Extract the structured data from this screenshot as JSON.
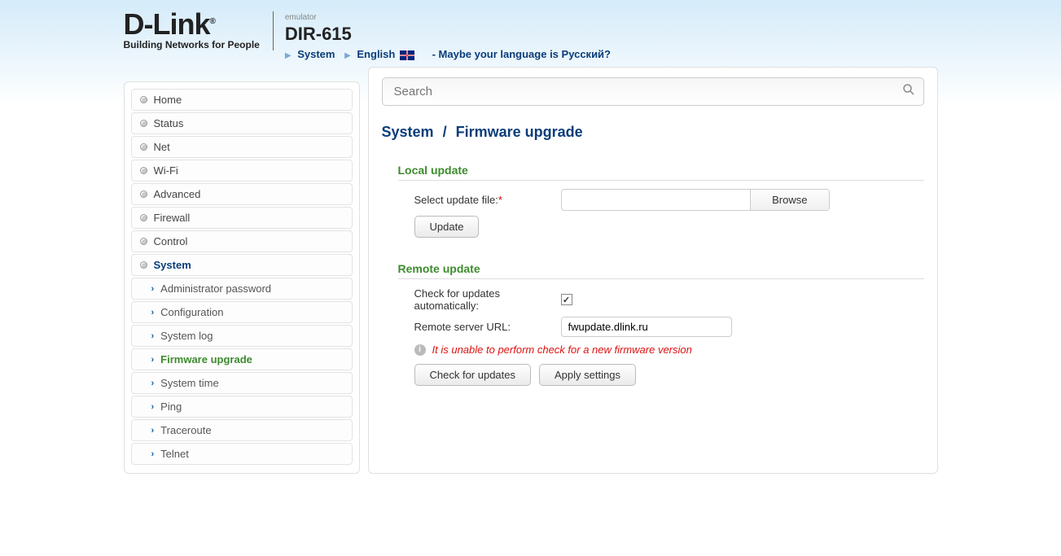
{
  "header": {
    "logo_main": "D-Link",
    "logo_tagline": "Building Networks for People",
    "emulator_label": "emulator",
    "model": "DIR-615",
    "breadcrumb_system": "System",
    "breadcrumb_lang": "English",
    "lang_suggest": "- Maybe your language is Русский?"
  },
  "sidebar": {
    "items": [
      {
        "label": "Home"
      },
      {
        "label": "Status"
      },
      {
        "label": "Net"
      },
      {
        "label": "Wi-Fi"
      },
      {
        "label": "Advanced"
      },
      {
        "label": "Firewall"
      },
      {
        "label": "Control"
      },
      {
        "label": "System",
        "active": true
      }
    ],
    "subitems": [
      {
        "label": "Administrator password"
      },
      {
        "label": "Configuration"
      },
      {
        "label": "System log"
      },
      {
        "label": "Firmware upgrade",
        "active": true
      },
      {
        "label": "System time"
      },
      {
        "label": "Ping"
      },
      {
        "label": "Traceroute"
      },
      {
        "label": "Telnet"
      }
    ]
  },
  "search": {
    "placeholder": "Search"
  },
  "page": {
    "crumb1": "System",
    "sep": "/",
    "crumb2": "Firmware upgrade"
  },
  "local": {
    "title": "Local update",
    "select_label": "Select update file:",
    "browse": "Browse",
    "update_btn": "Update"
  },
  "remote": {
    "title": "Remote update",
    "auto_label": "Check for updates automatically:",
    "auto_checked": true,
    "url_label": "Remote server URL:",
    "url_value": "fwupdate.dlink.ru",
    "error_msg": "It is unable to perform check for a new firmware version",
    "check_btn": "Check for updates",
    "apply_btn": "Apply settings"
  }
}
